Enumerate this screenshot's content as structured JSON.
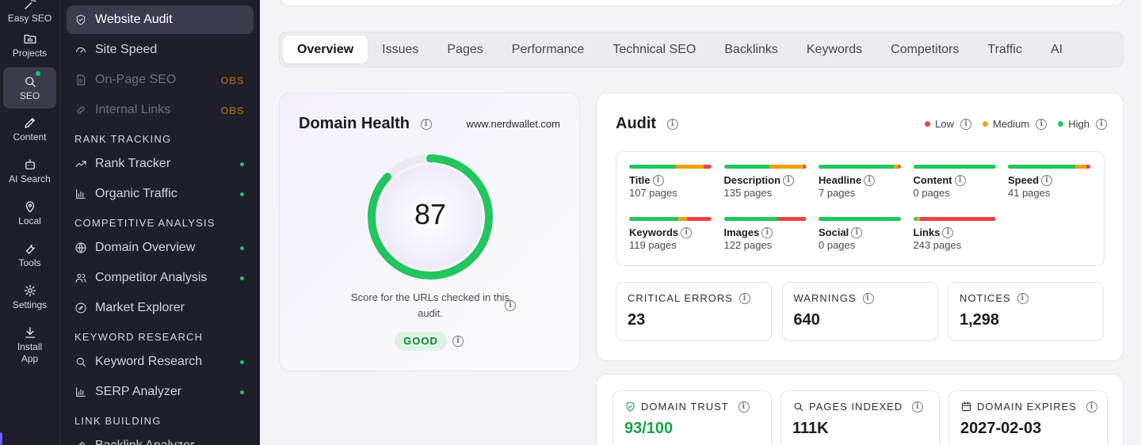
{
  "rail": {
    "items": [
      {
        "label": "Easy SEO",
        "icon": "wand-icon"
      },
      {
        "label": "Projects",
        "icon": "folder-icon"
      },
      {
        "label": "SEO",
        "icon": "search-icon"
      },
      {
        "label": "Content",
        "icon": "pen-icon"
      },
      {
        "label": "AI Search",
        "icon": "robot-icon"
      },
      {
        "label": "Local",
        "icon": "map-pin-icon"
      },
      {
        "label": "Tools",
        "icon": "wrench-icon"
      },
      {
        "label": "Settings",
        "icon": "gear-icon"
      },
      {
        "label": "Install App",
        "icon": "download-icon"
      }
    ]
  },
  "sidebar": {
    "items": [
      {
        "label": "Website Audit",
        "icon": "shield-icon"
      },
      {
        "label": "Site Speed",
        "icon": "gauge-icon"
      },
      {
        "label": "On-Page SEO",
        "badge": "OBS",
        "icon": "document-icon"
      },
      {
        "label": "Internal Links",
        "badge": "OBS",
        "icon": "link-icon"
      }
    ],
    "sections": [
      {
        "title": "RANK TRACKING",
        "items": [
          "Rank Tracker",
          "Organic Traffic"
        ]
      },
      {
        "title": "COMPETITIVE ANALYSIS",
        "items": [
          "Domain Overview",
          "Competitor Analysis",
          "Market Explorer"
        ]
      },
      {
        "title": "KEYWORD RESEARCH",
        "items": [
          "Keyword Research",
          "SERP Analyzer"
        ]
      },
      {
        "title": "LINK BUILDING",
        "items": [
          "Backlink Analyzer"
        ]
      }
    ]
  },
  "tabs": [
    "Overview",
    "Issues",
    "Pages",
    "Performance",
    "Technical SEO",
    "Backlinks",
    "Keywords",
    "Competitors",
    "Traffic",
    "AI"
  ],
  "health": {
    "title": "Domain Health",
    "domain": "www.nerdwallet.com",
    "score": "87",
    "score_fraction": 0.87,
    "caption": "Score for the URLs checked in this audit.",
    "status": "GOOD"
  },
  "audit": {
    "title": "Audit",
    "legend": [
      {
        "label": "Low",
        "color": "#ef4444"
      },
      {
        "label": "Medium",
        "color": "#f59e0b"
      },
      {
        "label": "High",
        "color": "#22c55e"
      }
    ],
    "metrics": [
      {
        "name": "Title",
        "sub": "107 pages",
        "bar": [
          0.57,
          0.33,
          0.1
        ]
      },
      {
        "name": "Description",
        "sub": "135 pages",
        "bar": [
          0.55,
          0.42,
          0.03
        ]
      },
      {
        "name": "Headline",
        "sub": "7 pages",
        "bar": [
          0.91,
          0.06,
          0.03
        ]
      },
      {
        "name": "Content",
        "sub": "0 pages",
        "bar": [
          1.0,
          0,
          0
        ]
      },
      {
        "name": "Speed",
        "sub": "41 pages",
        "bar": [
          0.82,
          0.13,
          0.05
        ]
      },
      {
        "name": "Keywords",
        "sub": "119 pages",
        "bar": [
          0.6,
          0.1,
          0.3
        ]
      },
      {
        "name": "Images",
        "sub": "122 pages",
        "bar": [
          0.65,
          0,
          0.35
        ]
      },
      {
        "name": "Social",
        "sub": "0 pages",
        "bar": [
          1.0,
          0,
          0
        ]
      },
      {
        "name": "Links",
        "sub": "243 pages",
        "bar": [
          0.04,
          0.04,
          0.92
        ]
      }
    ],
    "stats": [
      {
        "label": "CRITICAL ERRORS",
        "value": "23"
      },
      {
        "label": "WARNINGS",
        "value": "640"
      },
      {
        "label": "NOTICES",
        "value": "1,298"
      }
    ]
  },
  "domain_stats": [
    {
      "label": "DOMAIN TRUST",
      "value": "93/100",
      "icon": "shield-check-icon"
    },
    {
      "label": "PAGES INDEXED",
      "value": "111K",
      "icon": "search-icon"
    },
    {
      "label": "DOMAIN EXPIRES",
      "value": "2027-02-03",
      "icon": "calendar-icon"
    }
  ],
  "colors": {
    "good": "#22c55e",
    "medium": "#f59e0b",
    "low": "#ef4444",
    "sidebar_bg": "#1e1f2a"
  }
}
